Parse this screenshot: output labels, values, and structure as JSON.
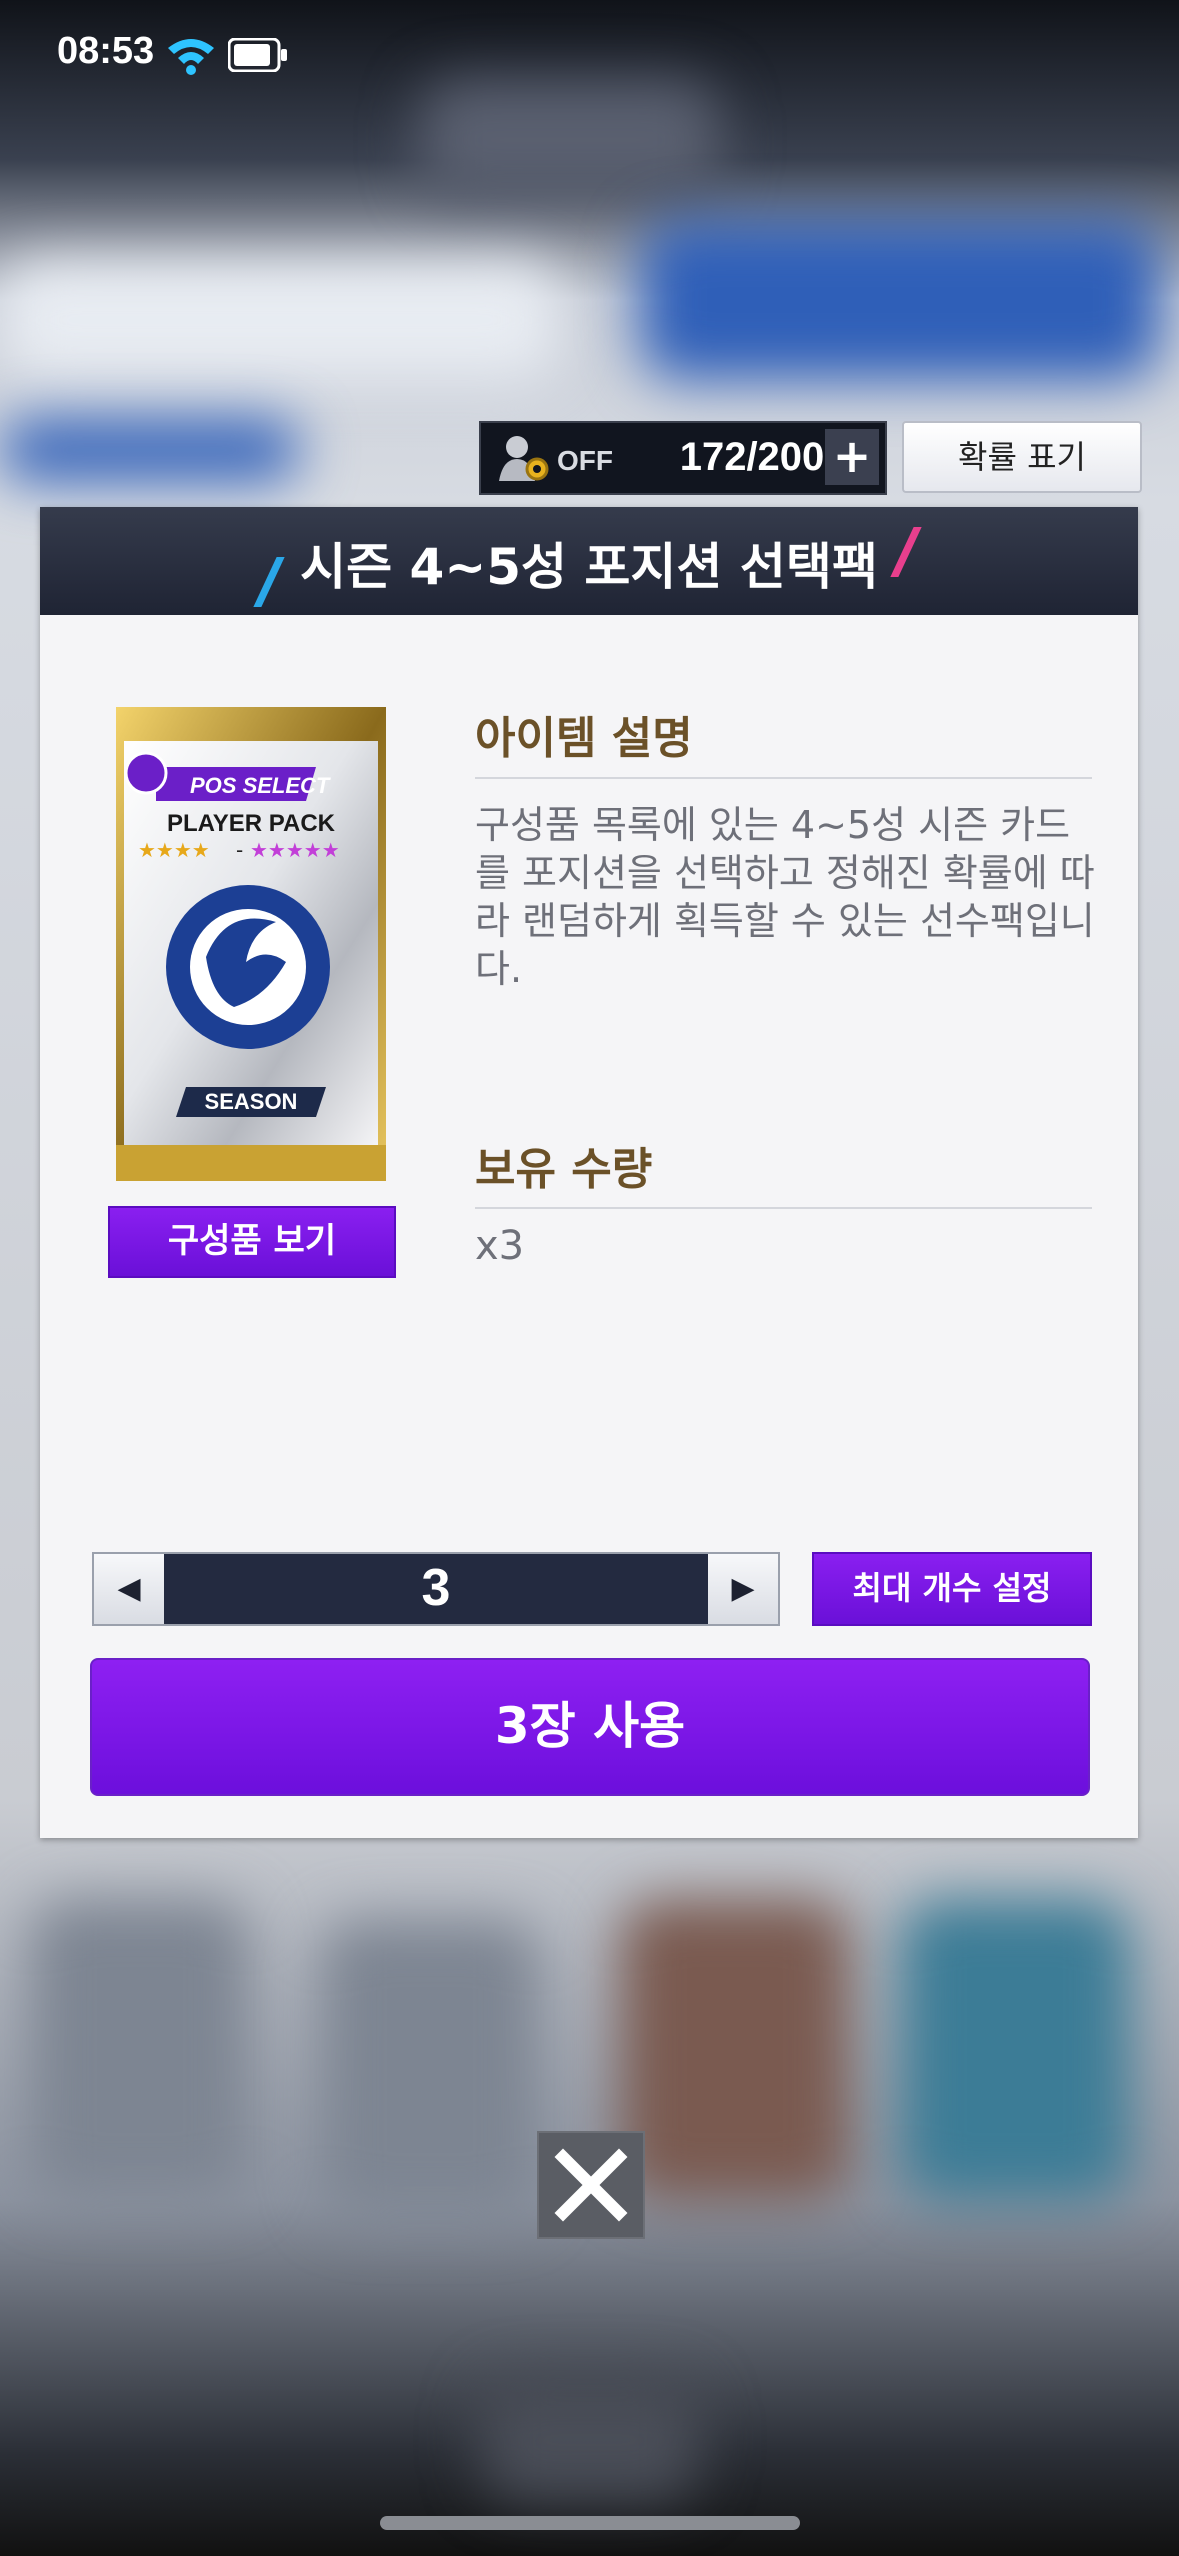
{
  "status_bar": {
    "time": "08:53"
  },
  "top_bar": {
    "auto_toggle_label": "OFF",
    "capacity": "172/200",
    "plus_label": "+",
    "probability_button": "확률 표기"
  },
  "panel": {
    "title": "시즌 4~5성 포지션 선택팩",
    "card": {
      "badge": "POS SELECT",
      "name": "PLAYER PACK",
      "stars_range": "-",
      "footer": "SEASON"
    },
    "view_contents_button": "구성품 보기",
    "description_heading": "아이템 설명",
    "description": "구성품 목록에 있는 4~5성 시즌 카드를 포지션을 선택하고 정해진 확률에 따라 랜덤하게 획득할 수 있는 선수팩입니다.",
    "owned_heading": "보유 수량",
    "owned_value": "x3",
    "stepper": {
      "value": "3",
      "dec_label": "◀",
      "inc_label": "▶"
    },
    "max_button": "최대 개수 설정",
    "use_button": "3장 사용"
  },
  "close_label": "✕",
  "colors": {
    "accent_purple": "#7a16e6",
    "header_navy": "#262c3e",
    "heading_brown": "#6b5128"
  }
}
